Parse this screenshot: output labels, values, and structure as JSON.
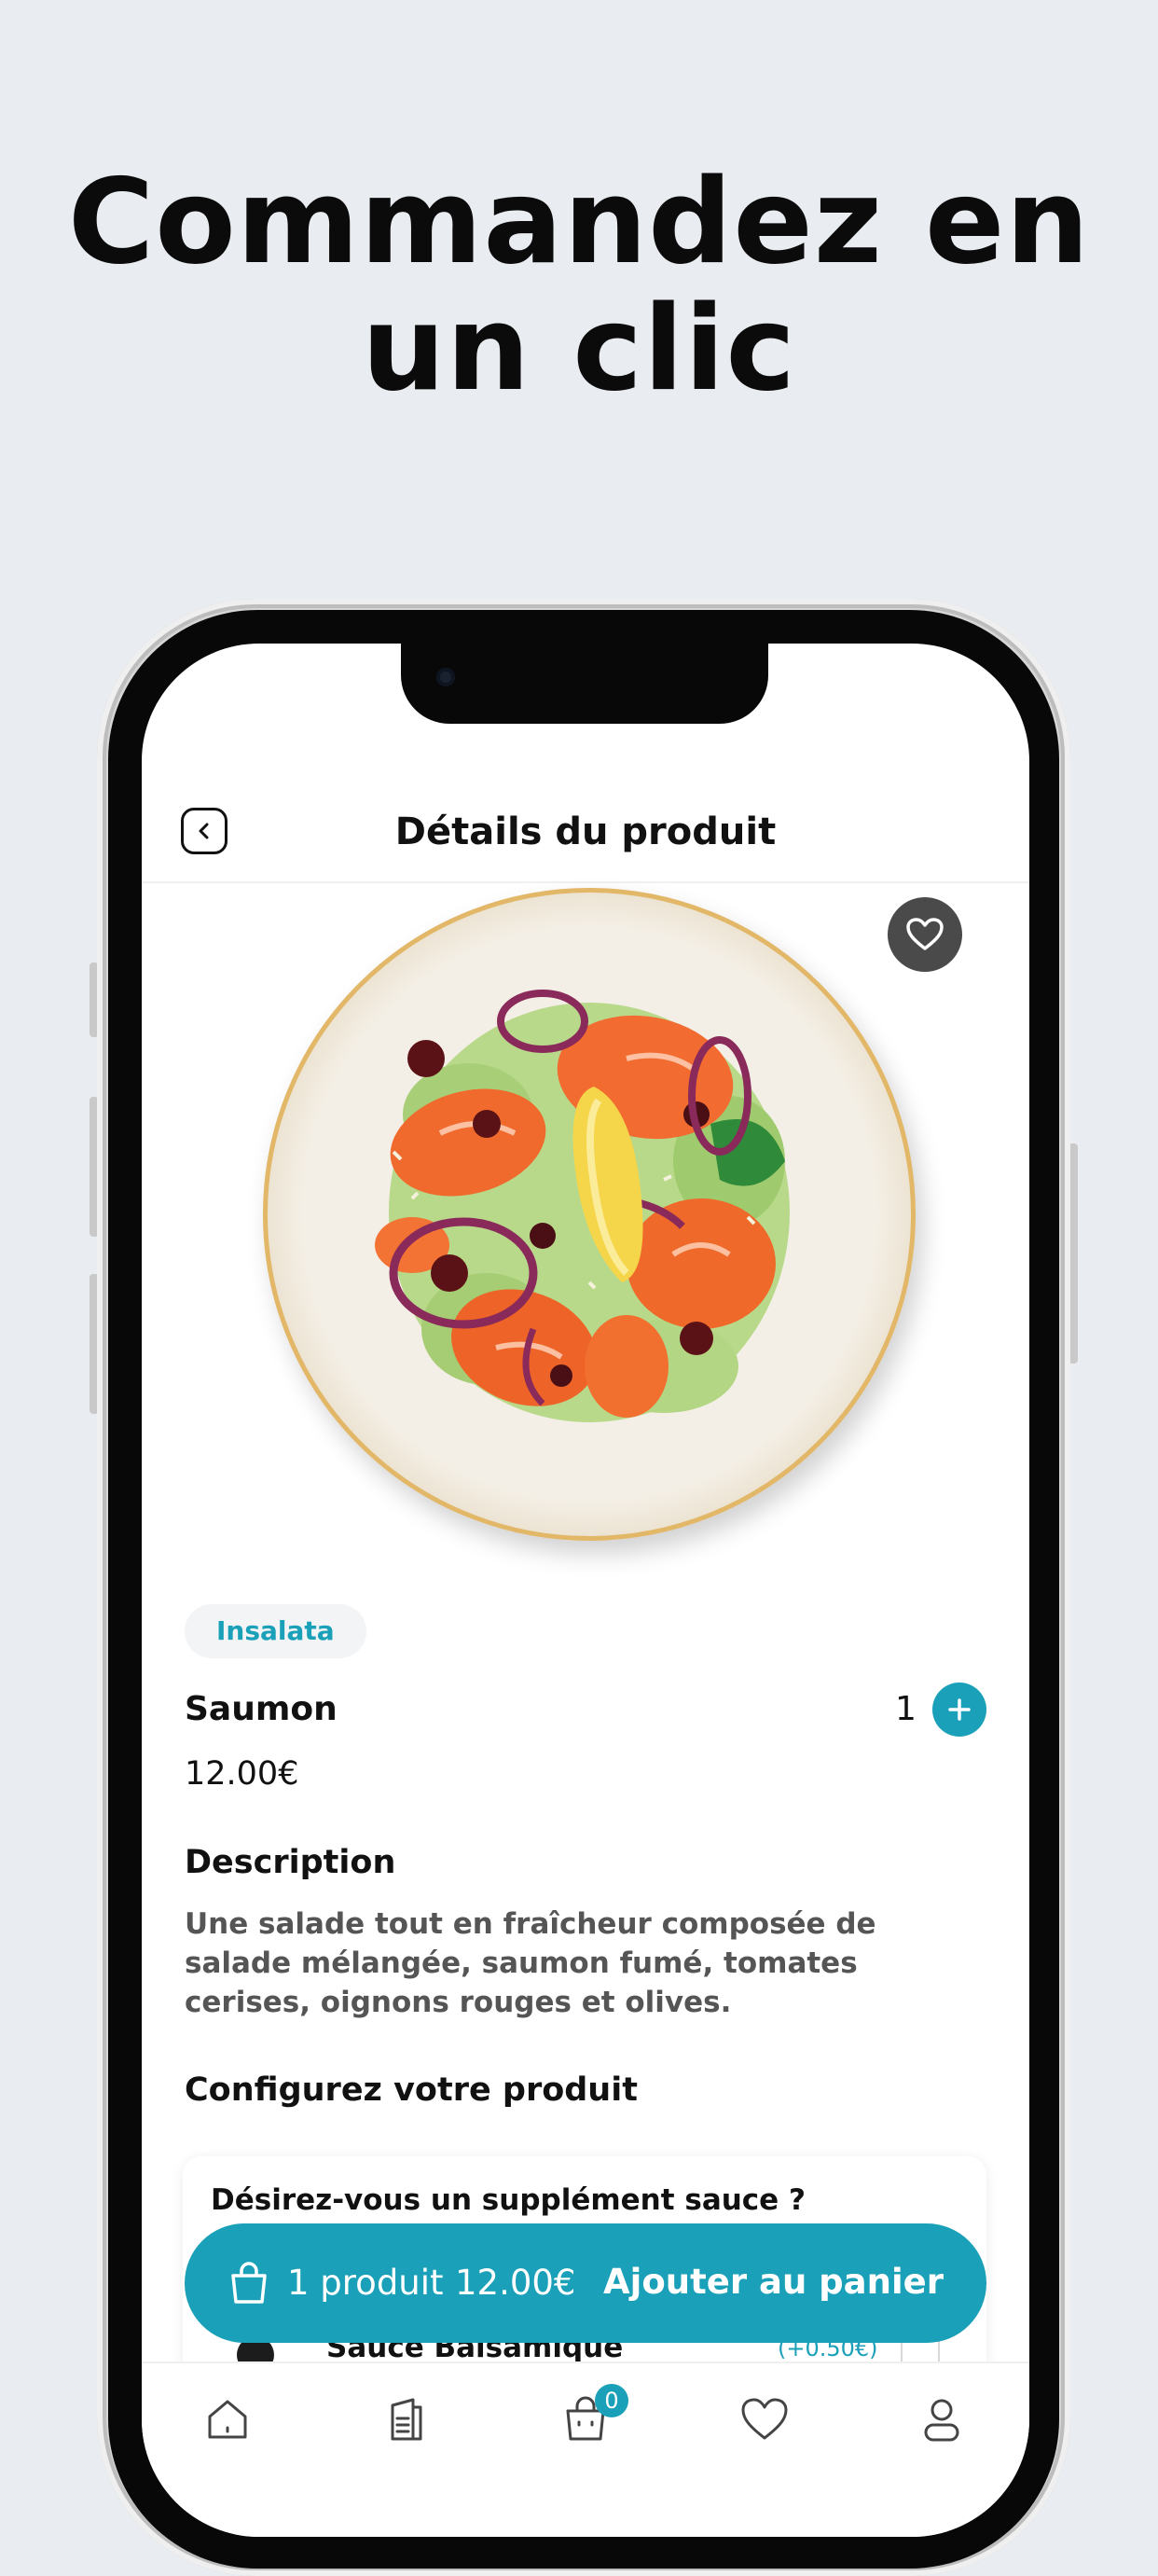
{
  "headline": {
    "line1": "Commandez en",
    "line2": "un clic"
  },
  "header": {
    "title": "Détails du produit"
  },
  "product": {
    "category": "Insalata",
    "name": "Saumon",
    "quantity": "1",
    "price": "12.00€",
    "description_title": "Description",
    "description": "Une salade tout en fraîcheur composée de salade mélangée, saumon fumé, tomates cerises, oignons rouges et olives."
  },
  "configure": {
    "title": "Configurez votre produit",
    "question": "Désirez-vous un supplément sauce ?",
    "option_name": "Sauce Balsamique",
    "option_price": "(+0.50€)"
  },
  "cart_bar": {
    "count_label": "1 produit",
    "total": "12.00€",
    "action_label": "Ajouter au panier"
  },
  "tabbar": {
    "items": [
      "home-icon",
      "menu-icon",
      "cart-icon",
      "favorites-icon",
      "profile-icon"
    ],
    "cart_badge": "0"
  },
  "colors": {
    "accent": "#1aa0b8",
    "background": "#e9edf1"
  }
}
